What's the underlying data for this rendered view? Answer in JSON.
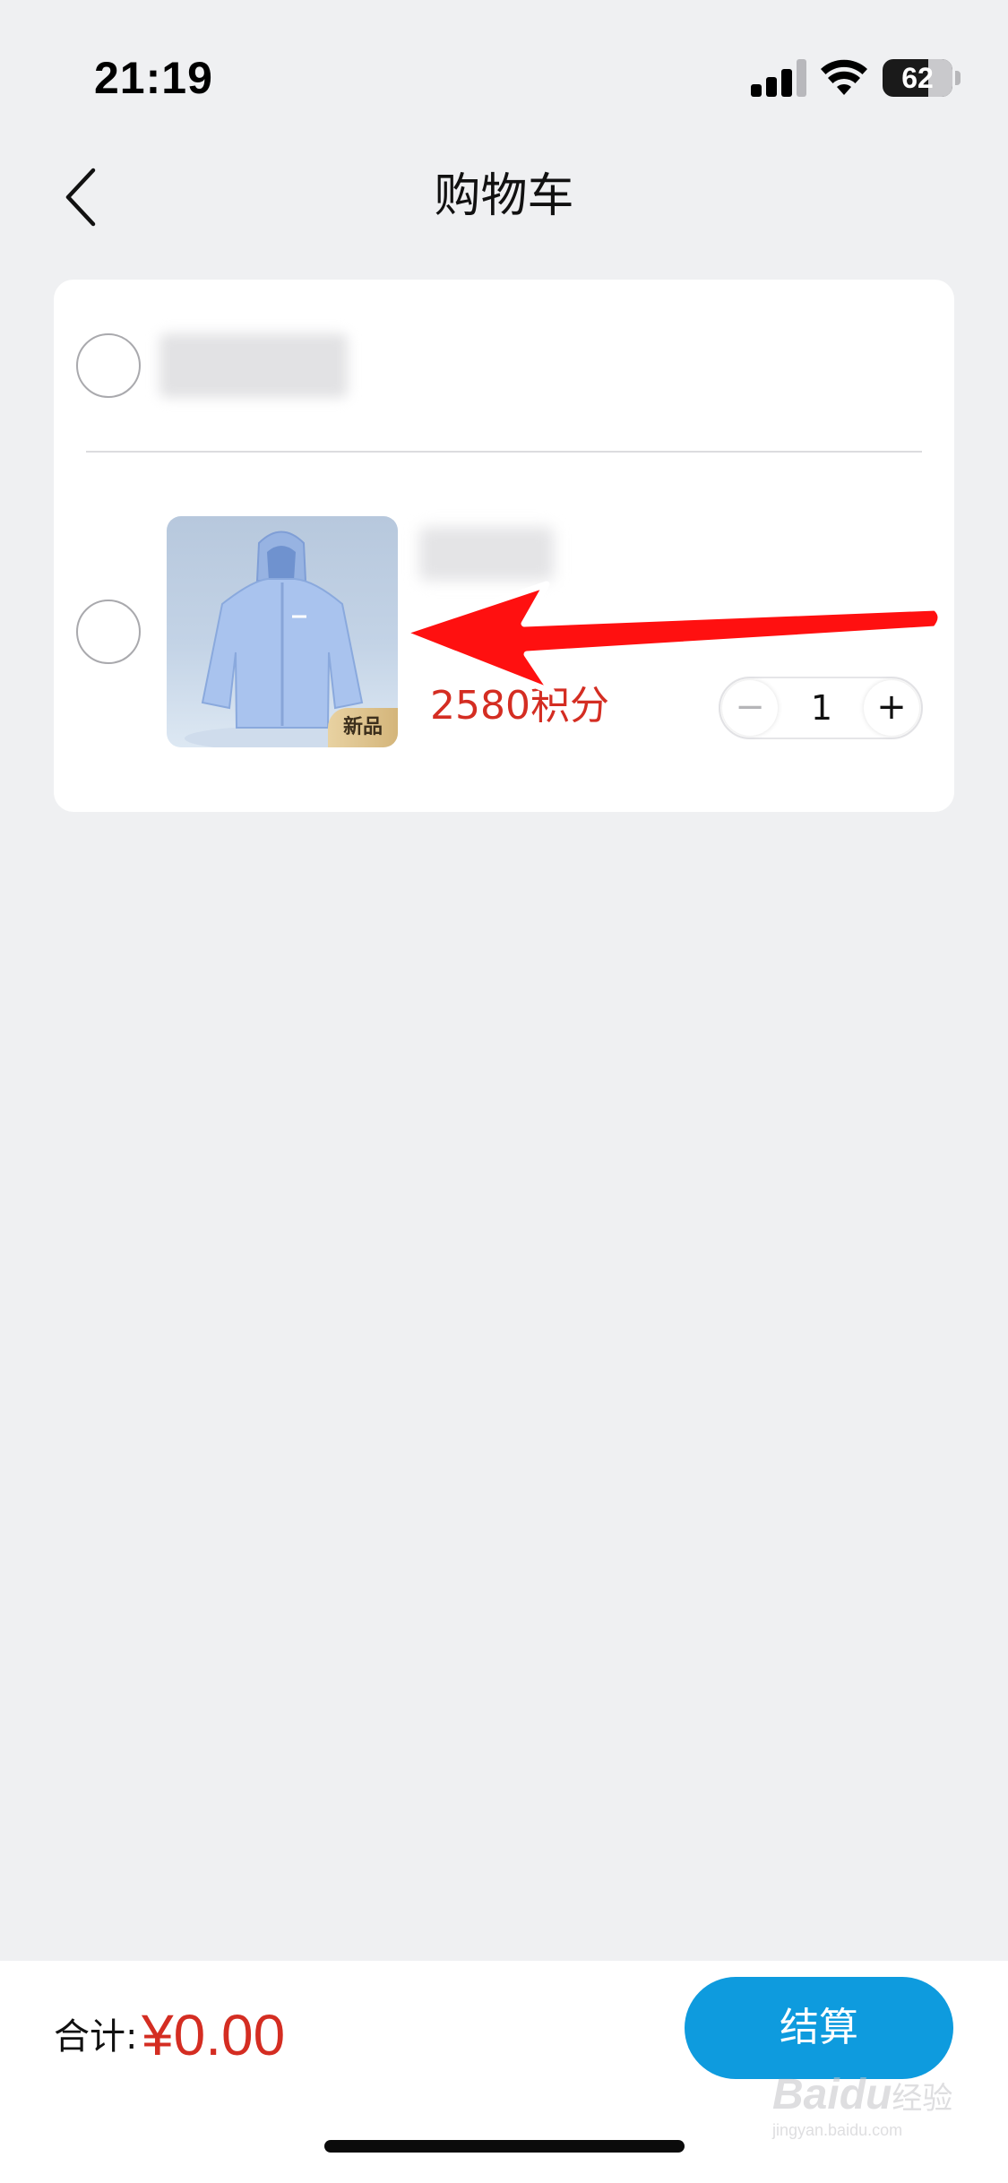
{
  "status_bar": {
    "time": "21:19",
    "battery_level": "62",
    "signal_bars": 3,
    "signal_bars_total": 4,
    "icons": [
      "signal-icon",
      "wifi-icon",
      "battery-icon"
    ]
  },
  "nav": {
    "back_icon": "chevron-left-icon",
    "title": "购物车"
  },
  "cart": {
    "store": {
      "selected": false,
      "name_obscured": true
    },
    "items": [
      {
        "selected": false,
        "name_obscured": true,
        "image_subject": "light-blue hooded jacket",
        "tag": "新品",
        "price": "2580积分",
        "quantity": "1",
        "decrement_label": "−",
        "increment_label": "+"
      }
    ]
  },
  "annotation": {
    "type": "red-arrow",
    "points_to": "product-image"
  },
  "footer": {
    "total_label": "合计:",
    "total_amount": "¥0.00",
    "checkout_label": "结算"
  },
  "watermark": {
    "logo": "Baidu",
    "logo_cn": "经验",
    "url": "jingyan.baidu.com"
  },
  "colors": {
    "page_background": "#eff0f2",
    "card_background": "#ffffff",
    "price_red": "#d42d22",
    "checkout_blue": "#0e9bde",
    "tag_gold": "#d4b57a",
    "annotation_red": "#ff1010"
  }
}
